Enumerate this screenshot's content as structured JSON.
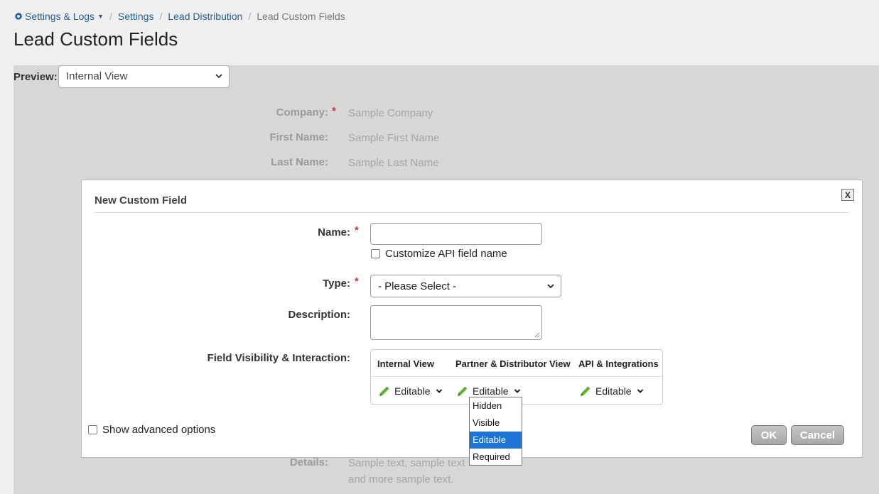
{
  "breadcrumb": {
    "root": "Settings & Logs",
    "item1": "Settings",
    "item2": "Lead Distribution",
    "current": "Lead Custom Fields"
  },
  "page_title": "Lead Custom Fields",
  "preview": {
    "label": "Preview:",
    "selected": "Internal View"
  },
  "sample_fields": {
    "company_label": "Company:",
    "company_value": "Sample Company",
    "first_name_label": "First Name:",
    "first_name_value": "Sample First Name",
    "last_name_label": "Last Name:",
    "last_name_value": "Sample Last Name",
    "details_label": "Details:",
    "details_line1": "Sample text, sample text",
    "details_line2": "and more sample text."
  },
  "modal": {
    "title": "New Custom Field",
    "close_label": "X",
    "name_label": "Name:",
    "customize_api_label": "Customize API field name",
    "type_label": "Type:",
    "type_selected": "- Please Select -",
    "description_label": "Description:",
    "visibility_label": "Field Visibility & Interaction:",
    "visibility": {
      "headers": [
        "Internal View",
        "Partner & Distributor View",
        "API & Integrations"
      ],
      "values": [
        "Editable",
        "Editable",
        "Editable"
      ]
    },
    "advanced_label": "Show advanced options",
    "ok_label": "OK",
    "cancel_label": "Cancel"
  },
  "dropdown": {
    "options": [
      "Hidden",
      "Visible",
      "Editable",
      "Required"
    ],
    "selected": "Editable"
  },
  "colors": {
    "link": "#1d5f9b",
    "required_star": "#d9272e",
    "pencil": "#5cb531",
    "dropdown_highlight": "#1e73d6",
    "overlay": "#d7d7d7"
  },
  "icons": [
    "gear-icon",
    "caret-down-icon",
    "chevron-down-icon",
    "pencil-icon",
    "close-icon"
  ]
}
